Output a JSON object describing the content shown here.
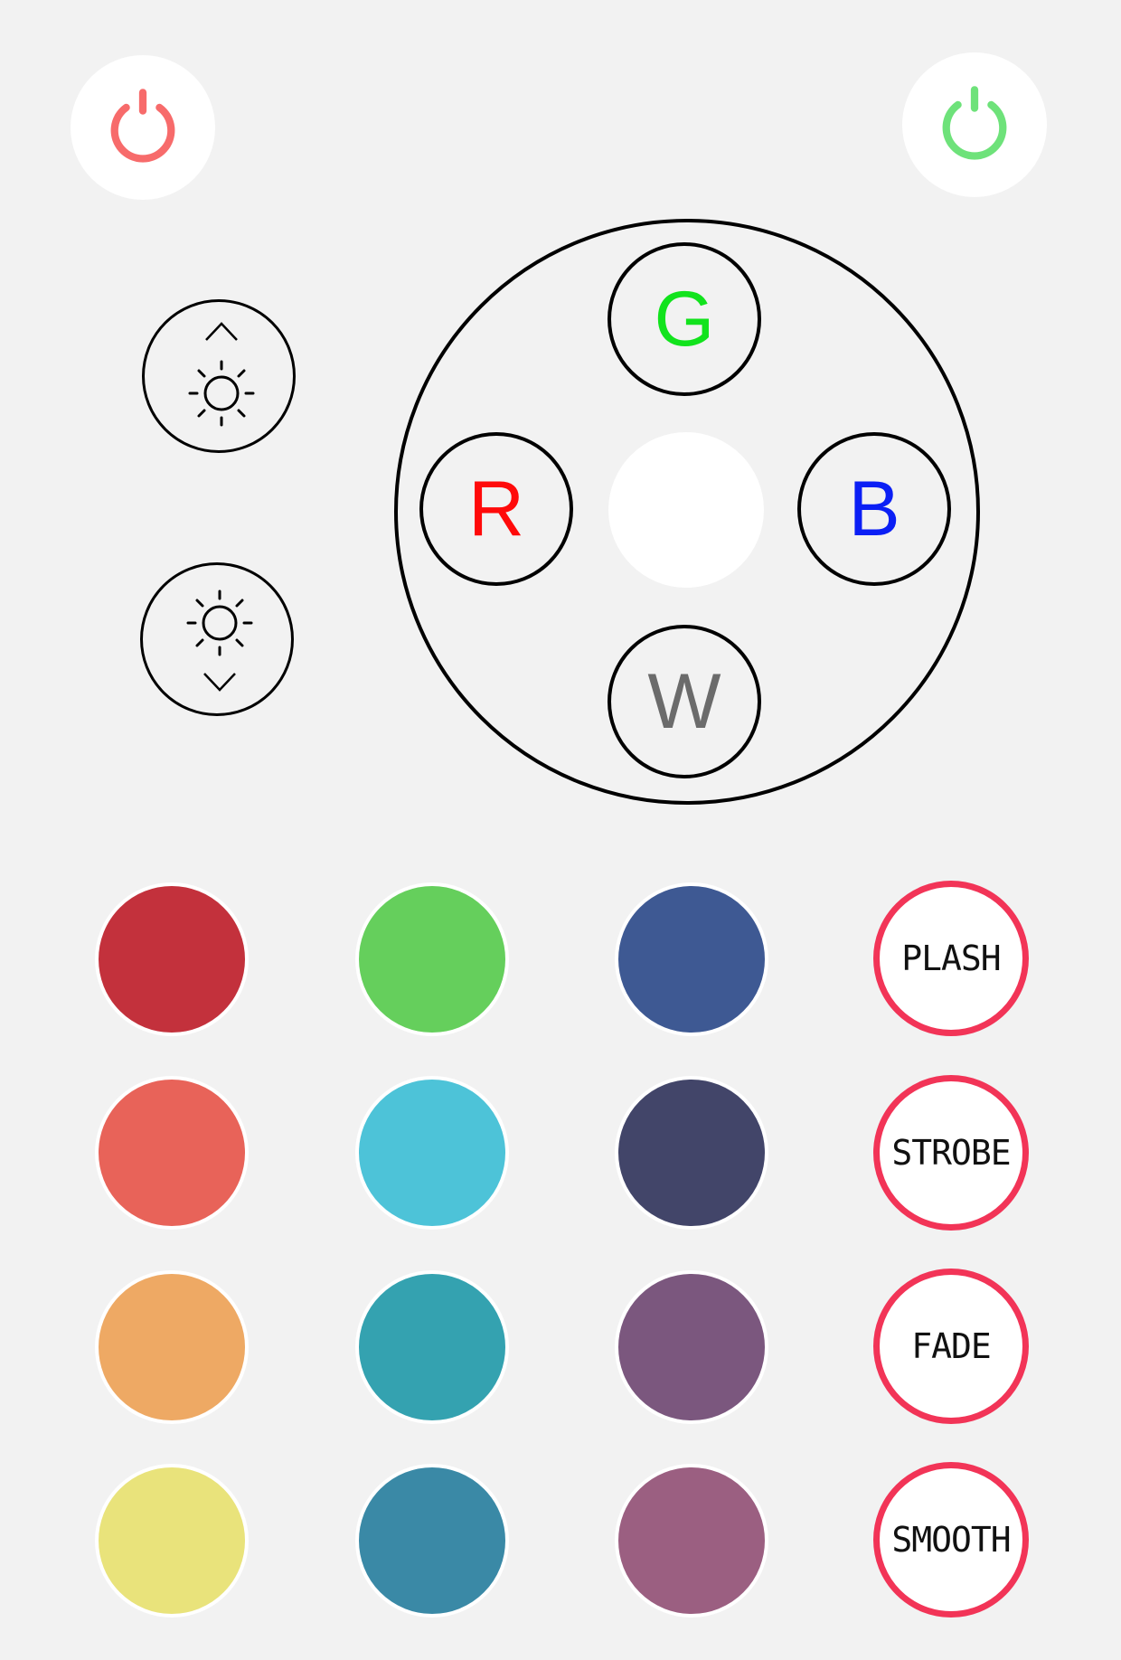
{
  "power": {
    "off": {
      "icon": "power-icon",
      "color": "#f76b6b"
    },
    "on": {
      "icon": "power-icon",
      "color": "#6ee27a"
    }
  },
  "brightness": {
    "up": {
      "icon": "brightness-up-icon"
    },
    "down": {
      "icon": "brightness-down-icon"
    }
  },
  "channels": {
    "green": {
      "label": "G",
      "color": "#12e31d"
    },
    "red": {
      "label": "R",
      "color": "#ff0a0a"
    },
    "blue": {
      "label": "B",
      "color": "#0b1ff5"
    },
    "white": {
      "label": "W",
      "color": "#6b6b6b"
    }
  },
  "swatches": [
    [
      "#c3313c",
      "#65cf5c",
      "#3e5993"
    ],
    [
      "#e86359",
      "#4dc3d8",
      "#424569"
    ],
    [
      "#eea964",
      "#34a2b0",
      "#7b577e"
    ],
    [
      "#e9e37b",
      "#3a89a6",
      "#9b5f81"
    ]
  ],
  "modes": [
    {
      "label": "PLASH"
    },
    {
      "label": "STROBE"
    },
    {
      "label": "FADE"
    },
    {
      "label": "SMOOTH"
    }
  ],
  "accent": "#f23457"
}
